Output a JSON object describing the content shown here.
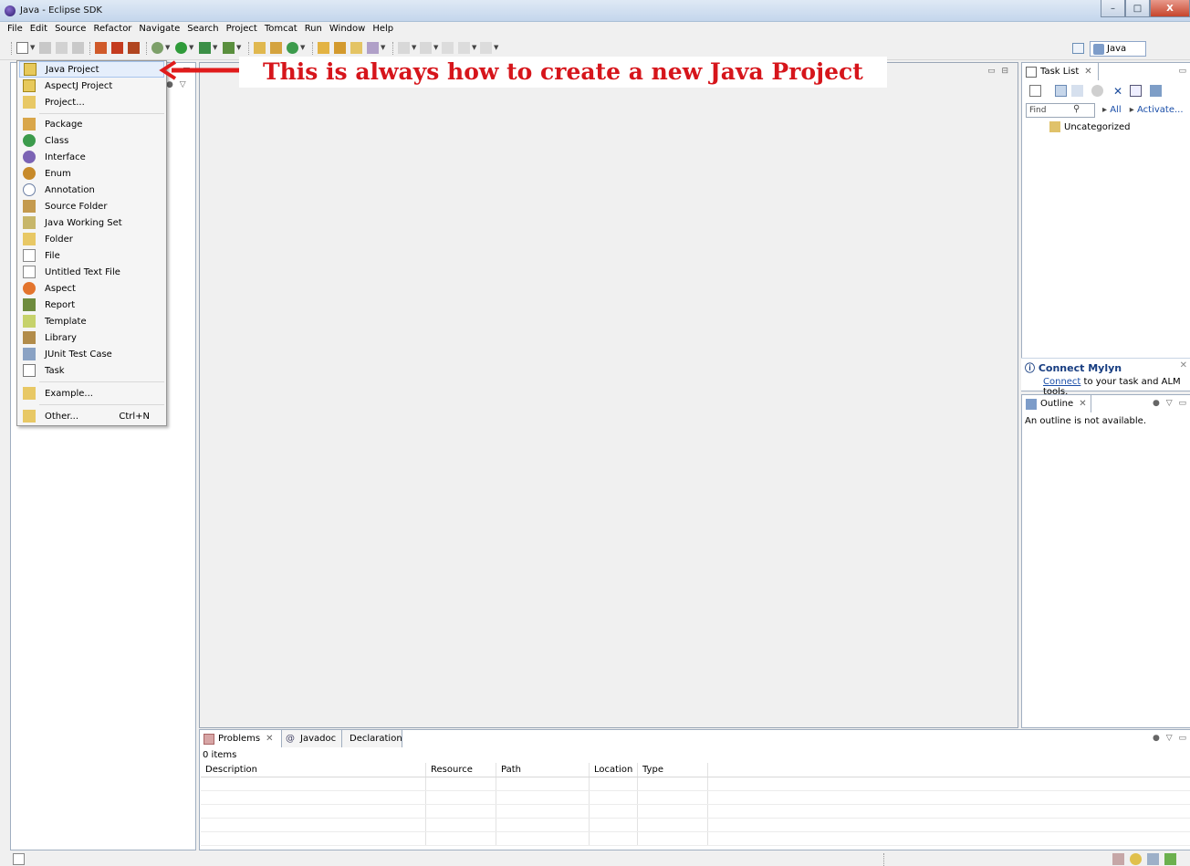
{
  "window": {
    "title": "Java - Eclipse SDK",
    "minimize": "–",
    "maximize": "□",
    "close": "X"
  },
  "menubar": [
    "File",
    "Edit",
    "Source",
    "Refactor",
    "Navigate",
    "Search",
    "Project",
    "Tomcat",
    "Run",
    "Window",
    "Help"
  ],
  "perspective": {
    "label": "Java"
  },
  "new_menu": {
    "items": [
      {
        "label": "Java Project",
        "icon": "java-project-icon",
        "highlighted": true
      },
      {
        "label": "AspectJ Project",
        "icon": "aspectj-project-icon"
      },
      {
        "label": "Project...",
        "icon": "project-icon"
      },
      {
        "label": "Package",
        "icon": "package-icon"
      },
      {
        "label": "Class",
        "icon": "class-icon"
      },
      {
        "label": "Interface",
        "icon": "interface-icon"
      },
      {
        "label": "Enum",
        "icon": "enum-icon"
      },
      {
        "label": "Annotation",
        "icon": "annotation-icon"
      },
      {
        "label": "Source Folder",
        "icon": "source-folder-icon"
      },
      {
        "label": "Java Working Set",
        "icon": "working-set-icon"
      },
      {
        "label": "Folder",
        "icon": "folder-icon"
      },
      {
        "label": "File",
        "icon": "file-icon"
      },
      {
        "label": "Untitled Text File",
        "icon": "text-file-icon"
      },
      {
        "label": "Aspect",
        "icon": "aspect-icon"
      },
      {
        "label": "Report",
        "icon": "report-icon"
      },
      {
        "label": "Template",
        "icon": "template-icon"
      },
      {
        "label": "Library",
        "icon": "library-icon"
      },
      {
        "label": "JUnit Test Case",
        "icon": "junit-icon"
      },
      {
        "label": "Task",
        "icon": "task-icon"
      },
      {
        "label": "Example...",
        "icon": "example-icon"
      },
      {
        "label": "Other...",
        "icon": "other-icon",
        "shortcut": "Ctrl+N"
      }
    ]
  },
  "annotation": {
    "text": "This is always how to create a new Java Project",
    "color": "#d6151b"
  },
  "tasklist": {
    "tab": "Task List",
    "find_placeholder": "Find",
    "link_all": "All",
    "link_activate": "Activate...",
    "category": "Uncategorized"
  },
  "mylyn": {
    "title": "Connect Mylyn",
    "link": "Connect",
    "text": " to your task and ALM tools."
  },
  "outline": {
    "tab": "Outline",
    "message": "An outline is not available."
  },
  "problems": {
    "tabs": [
      "Problems",
      "Javadoc",
      "Declaration"
    ],
    "count": "0 items",
    "columns": [
      "Description",
      "Resource",
      "Path",
      "Location",
      "Type"
    ]
  },
  "colors": {
    "accent": "#1a4ea8",
    "highlight": "#e5eefb",
    "annotation": "#d6151b"
  }
}
